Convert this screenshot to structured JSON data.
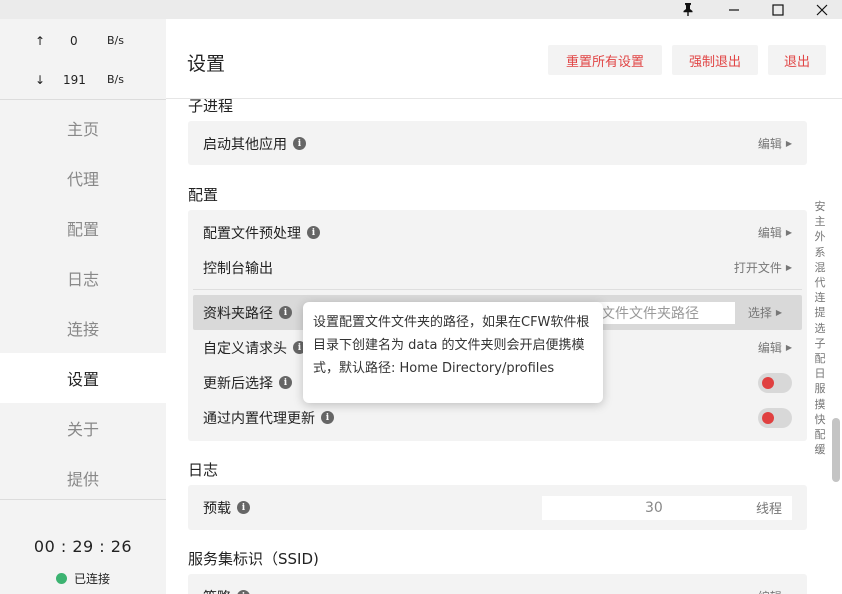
{
  "titlebar": {
    "pin_icon": "pin-icon",
    "min_icon": "minimize-icon",
    "max_icon": "maximize-icon",
    "close_icon": "close-icon"
  },
  "sidebar": {
    "upload": {
      "arrow": "↑",
      "value": "0",
      "unit": "B/s"
    },
    "download": {
      "arrow": "↓",
      "value": "191",
      "unit": "B/s"
    },
    "items": [
      {
        "label": "主页"
      },
      {
        "label": "代理"
      },
      {
        "label": "配置"
      },
      {
        "label": "日志"
      },
      {
        "label": "连接"
      },
      {
        "label": "设置",
        "active": true
      },
      {
        "label": "关于"
      },
      {
        "label": "提供"
      }
    ],
    "clock": "00 : 29 : 26",
    "status": "已连接",
    "status_color": "#3cb371"
  },
  "header": {
    "title": "设置",
    "reset_label": "重置所有设置",
    "force_quit_label": "强制退出",
    "quit_label": "退出",
    "button_text_color": "#e14545"
  },
  "sections": {
    "child_process": {
      "title": "子进程",
      "rows": [
        {
          "label": "启动其他应用",
          "action": "编辑"
        }
      ]
    },
    "config": {
      "title": "配置",
      "rows": [
        {
          "label": "配置文件预处理",
          "action": "编辑"
        },
        {
          "label": "控制台输出",
          "action": "打开文件"
        },
        {
          "label": "资料夹路径",
          "placeholder": "文件文件夹路径",
          "action": "选择"
        },
        {
          "label": "自定义请求头",
          "action": "编辑"
        },
        {
          "label": "更新后选择",
          "toggle": true
        },
        {
          "label": "通过内置代理更新",
          "toggle": true
        }
      ]
    },
    "log": {
      "title": "日志",
      "rows": [
        {
          "label": "预载",
          "value": "30",
          "unit": "线程"
        }
      ]
    },
    "ssid": {
      "title": "服务集标识（SSID)",
      "rows": [
        {
          "label": "策略",
          "action": "编辑"
        }
      ]
    }
  },
  "tooltip": {
    "text": "设置配置文件文件夹的路径，如果在CFW软件根目录下创建名为 data 的文件夹则会开启便携模式，默认路径: Home Directory/profiles"
  },
  "index_ruler": [
    "安",
    "主",
    "外",
    "系",
    "混",
    "代",
    "连",
    "提",
    "选",
    "子",
    "配",
    "日",
    "服",
    "摸",
    "快",
    "配",
    "缓"
  ]
}
